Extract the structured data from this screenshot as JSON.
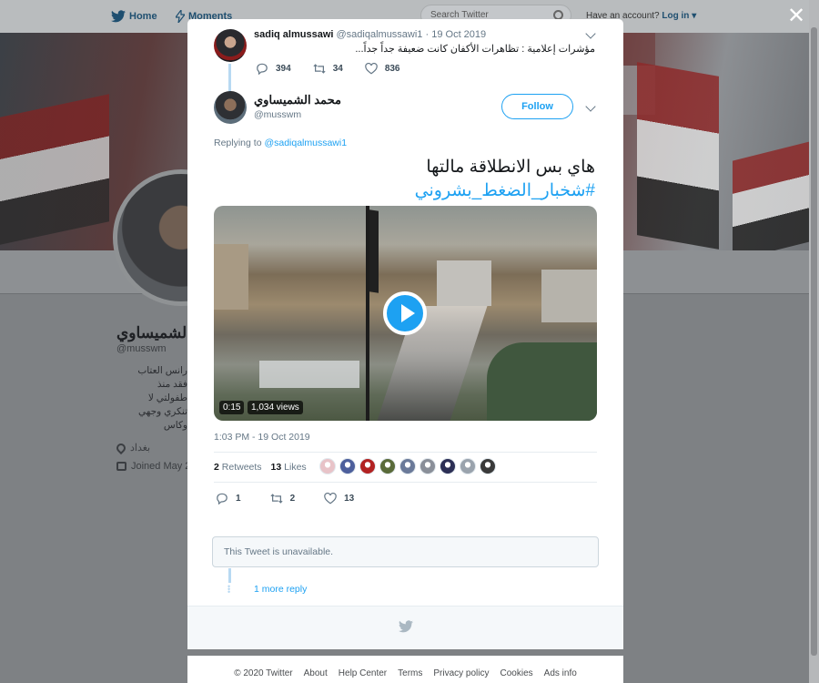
{
  "nav": {
    "home": "Home",
    "moments": "Moments",
    "search_placeholder": "Search Twitter",
    "account_prompt": "Have an account?",
    "login": "Log in"
  },
  "profile": {
    "name": "الشميساوي",
    "handle": "@musswm",
    "bio": "رانس العتاب فقد منذ طفولتي لا تنكري وجهي وكاس",
    "location": "بغداد",
    "joined": "Joined May 2"
  },
  "parent_tweet": {
    "name": "sadiq almussawi",
    "handle": "@sadiqalmussawi1",
    "date": "· 19 Oct 2019",
    "text": "مؤشرات إعلامية : تظاهرات الأكفان كانت ضعيفة جداً جداً...",
    "replies": "394",
    "retweets": "34",
    "likes": "836"
  },
  "tweet": {
    "name": "محمد الشميساوي",
    "handle": "@musswm",
    "follow_label": "Follow",
    "replying_prefix": "Replying to",
    "replying_to": "@sadiqalmussawi1",
    "text": "هاي بس الانطلاقة مالتها",
    "hashtag": "#شخبار_الضغط_بشروني",
    "video_duration": "0:15",
    "video_views": "1,034 views",
    "timestamp": "1:03 PM - 19 Oct 2019",
    "retweet_count": "2",
    "retweet_label": "Retweets",
    "like_count": "13",
    "like_label": "Likes",
    "replies": "1",
    "retweets": "2",
    "likes": "13"
  },
  "liker_colors": [
    "#e8c3c8",
    "#4d5f9c",
    "#b22222",
    "#5a6b3a",
    "#6b7a99",
    "#8a8f99",
    "#2c2f55",
    "#9aa3ad",
    "#3a3a3a"
  ],
  "unavailable_text": "This Tweet is unavailable.",
  "more_reply": "1 more reply",
  "footer": [
    "© 2020 Twitter",
    "About",
    "Help Center",
    "Terms",
    "Privacy policy",
    "Cookies",
    "Ads info"
  ],
  "colors": {
    "accent": "#1da1f2",
    "overlay": "#7e8184"
  },
  "icons": {
    "close": "close-icon",
    "reply": "reply-icon",
    "retweet": "retweet-icon",
    "like": "heart-icon",
    "bird": "twitter-bird-icon"
  }
}
